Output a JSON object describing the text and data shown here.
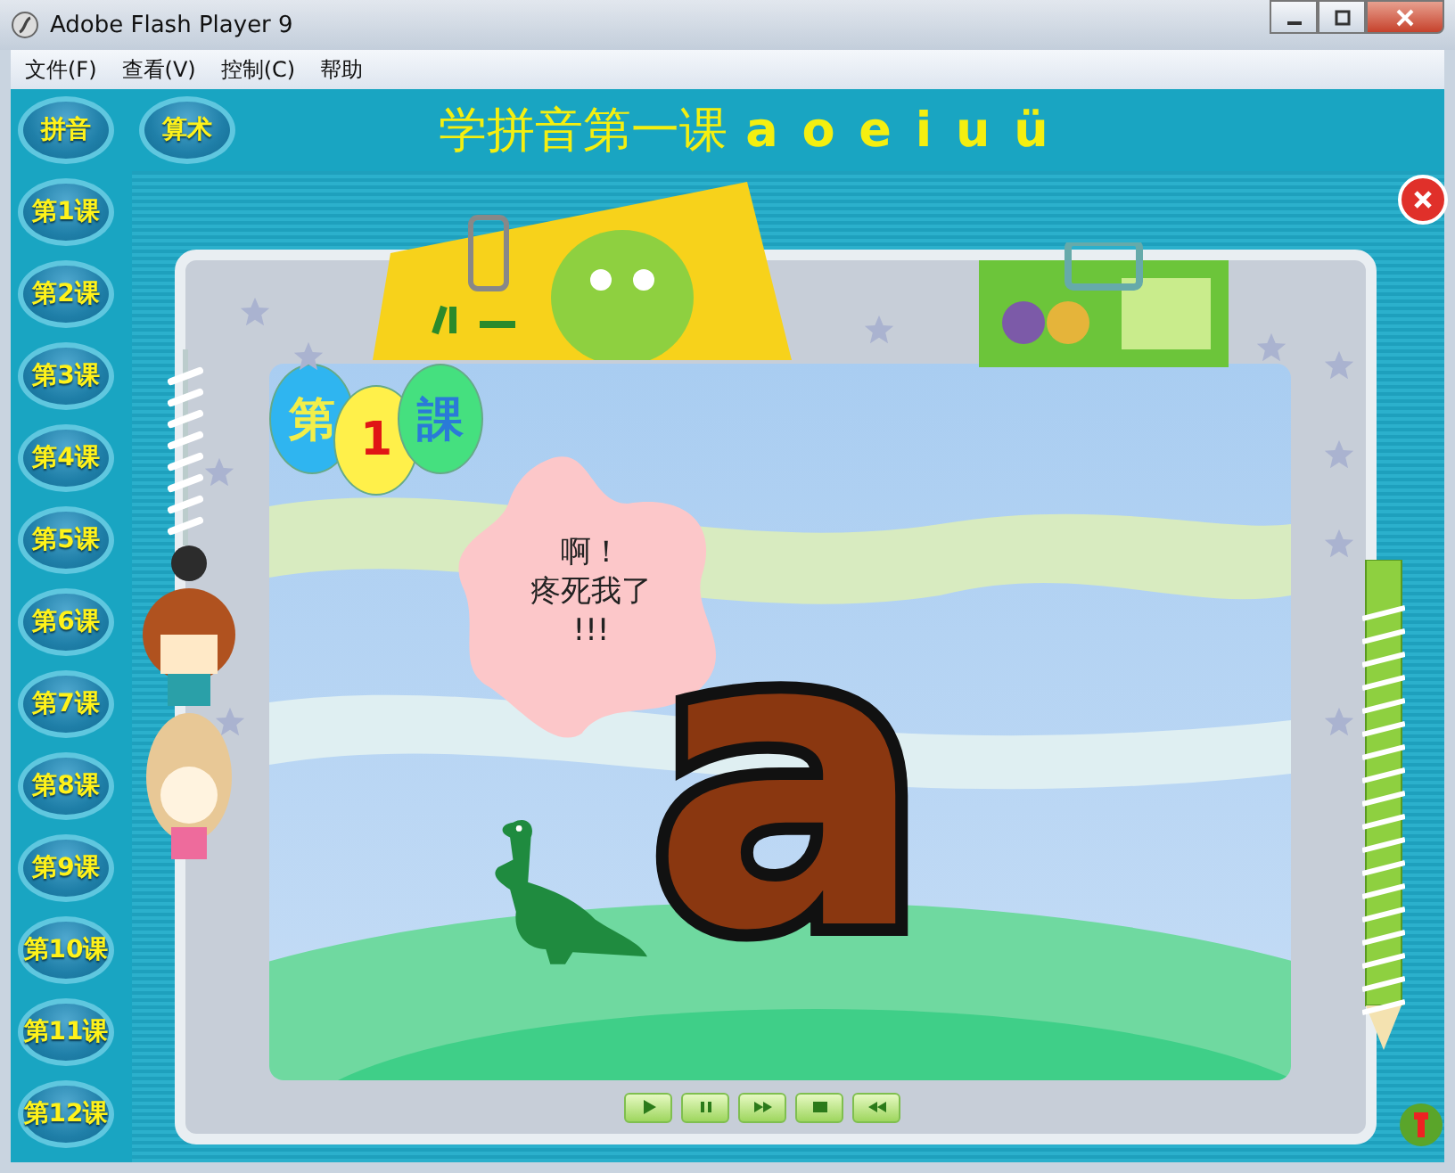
{
  "window": {
    "title": "Adobe Flash Player 9"
  },
  "menu": [
    "文件(F)",
    "查看(V)",
    "控制(C)",
    "帮助"
  ],
  "header": {
    "buttons": [
      "拼音",
      "算术"
    ],
    "title": "学拼音第一课",
    "title_letters": "a o e i u ü"
  },
  "lessons": [
    "第1课",
    "第2课",
    "第3课",
    "第4课",
    "第5课",
    "第6课",
    "第7课",
    "第8课",
    "第9课",
    "第10课",
    "第11课",
    "第12课"
  ],
  "stage": {
    "balloons": [
      {
        "text": "第",
        "color": "#2fb5f0"
      },
      {
        "text": "1",
        "color": "#fff04a"
      },
      {
        "text": "課",
        "color": "#45e07f"
      }
    ],
    "speech": [
      "啊！",
      "疼死我了",
      "!!!"
    ],
    "letter": "a"
  },
  "controls": [
    {
      "kind": "play"
    },
    {
      "kind": "pause"
    },
    {
      "kind": "forward"
    },
    {
      "kind": "stop"
    },
    {
      "kind": "rewind"
    }
  ]
}
